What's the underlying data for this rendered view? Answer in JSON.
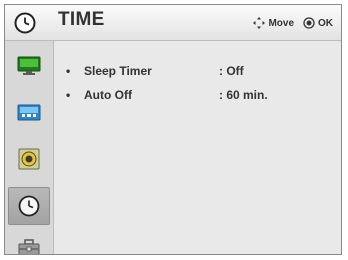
{
  "header": {
    "title": "TIME",
    "hints": {
      "move_label": "Move",
      "ok_label": "OK"
    }
  },
  "sidebar": {
    "items": [
      {
        "icon": "picture-icon",
        "active": false
      },
      {
        "icon": "screen-icon",
        "active": false
      },
      {
        "icon": "audio-icon",
        "active": false
      },
      {
        "icon": "clock-icon",
        "active": true
      },
      {
        "icon": "toolbox-icon",
        "active": false
      }
    ]
  },
  "menu": {
    "bullet": "•",
    "items": [
      {
        "label": "Sleep Timer",
        "value": ": Off"
      },
      {
        "label": "Auto Off",
        "value": ": 60 min."
      }
    ]
  },
  "colors": {
    "panel_bg": "#e9e9e9",
    "text": "#333333",
    "active_tab": "#a8a8a8"
  }
}
